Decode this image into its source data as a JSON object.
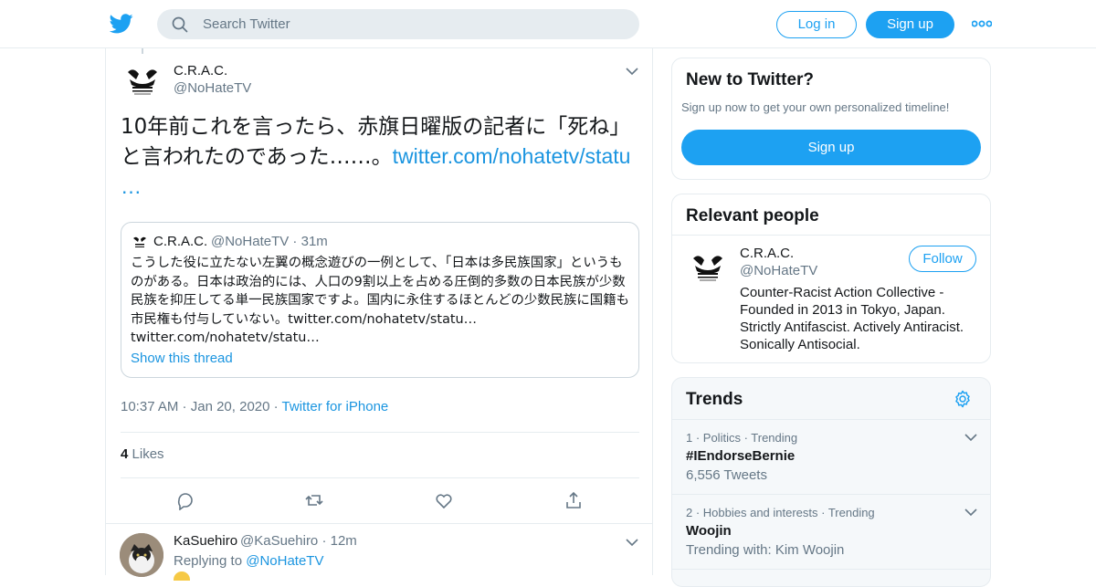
{
  "header": {
    "search_placeholder": "Search Twitter",
    "login_label": "Log in",
    "signup_label": "Sign up"
  },
  "tweet": {
    "name": "C.R.A.C.",
    "handle": "@NoHateTV",
    "text": "10年前これを言ったら、赤旗日曜版の記者に「死ね」と言われたのであった……。",
    "link": "twitter.com/nohatetv/statu",
    "link_ellipsis": "…",
    "time": "10:37 AM",
    "date": "Jan 20, 2020",
    "source": "Twitter for iPhone",
    "likes_count": "4",
    "likes_label": "Likes"
  },
  "quote": {
    "name": "C.R.A.C.",
    "handle": "@NoHateTV",
    "age": "31m",
    "text": "こうした役に立たない左翼の概念遊びの一例として、「日本は多民族国家」というものがある。日本は政治的には、人口の9割以上を占める圧倒的多数の日本民族が少数民族を抑圧してる単一民族国家ですよ。国内に永住するほとんどの少数民族に国籍も市民権も付与していない。twitter.com/nohatetv/statu…",
    "text2": "twitter.com/nohatetv/statu…",
    "show_thread": "Show this thread"
  },
  "reply": {
    "name": "KaSuehiro",
    "handle": "@KaSuehiro",
    "age": "12m",
    "replying_prefix": "Replying to",
    "replying_to": "@NoHateTV"
  },
  "new_to_twitter": {
    "title": "New to Twitter?",
    "subtitle": "Sign up now to get your own personalized timeline!",
    "button": "Sign up"
  },
  "relevant_people": {
    "title": "Relevant people",
    "name": "C.R.A.C.",
    "handle": "@NoHateTV",
    "follow": "Follow",
    "bio": "Counter-Racist Action Collective - Founded in 2013 in Tokyo, Japan. Strictly Antifascist. Actively Antiracist. Sonically Antisocial."
  },
  "trends": {
    "title": "Trends",
    "items": [
      {
        "context": "1 · Politics · Trending",
        "name": "#IEndorseBernie",
        "sub": "6,556 Tweets"
      },
      {
        "context": "2 · Hobbies and interests · Trending",
        "name": "Woojin",
        "sub": "Trending with: Kim Woojin"
      }
    ]
  },
  "colors": {
    "accent": "#1da1f2",
    "link": "#1b95e0",
    "muted": "#657786",
    "border": "#e6ecf0"
  }
}
